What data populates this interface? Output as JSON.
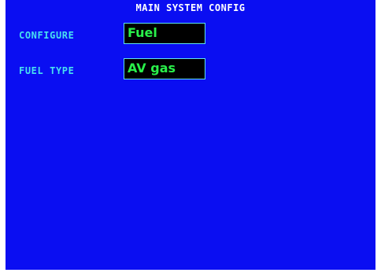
{
  "screen": {
    "title": "MAIN SYSTEM CONFIG"
  },
  "rows": [
    {
      "label": "CONFIGURE",
      "value": "Fuel"
    },
    {
      "label": "FUEL TYPE",
      "value": "AV gas"
    }
  ],
  "colors": {
    "background": "#0a0ef2",
    "title_text": "#ffffff",
    "label_text": "#48e0f0",
    "field_background": "#000000",
    "field_border": "#5fe2f2",
    "field_text": "#29f04a"
  }
}
